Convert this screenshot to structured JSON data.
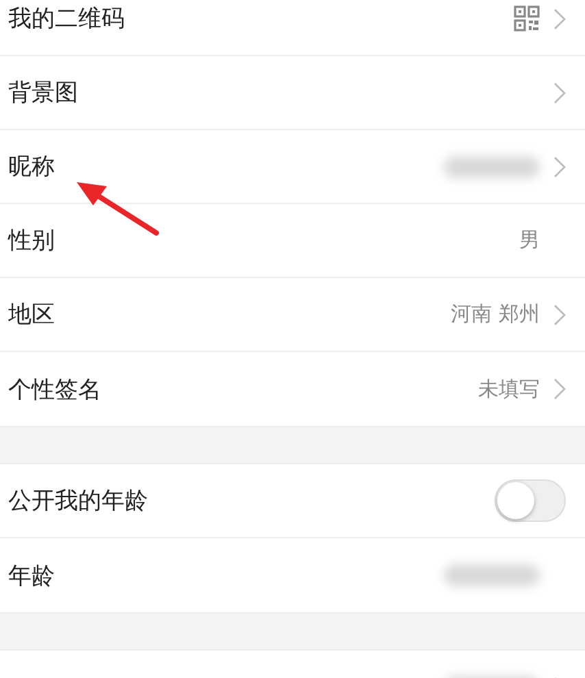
{
  "sections": [
    {
      "rows": [
        {
          "kind": "qr",
          "label": "我的二维码",
          "chevron": true,
          "blurred": false
        },
        {
          "kind": "link",
          "label": "背景图",
          "chevron": true,
          "blurred": false
        },
        {
          "kind": "link",
          "label": "昵称",
          "chevron": true,
          "blurred": true
        },
        {
          "kind": "link",
          "label": "性别",
          "value": "男",
          "chevron": false,
          "blurred": false
        },
        {
          "kind": "link",
          "label": "地区",
          "value": "河南 郑州",
          "chevron": true,
          "blurred": false
        },
        {
          "kind": "link",
          "label": "个性签名",
          "value": "未填写",
          "chevron": true,
          "blurred": false
        }
      ]
    },
    {
      "rows": [
        {
          "kind": "toggle",
          "label": "公开我的年龄",
          "on": false
        },
        {
          "kind": "link",
          "label": "年龄",
          "chevron": false,
          "blurred": true
        }
      ]
    },
    {
      "rows": [
        {
          "kind": "link",
          "chevron": true,
          "blurred": true
        }
      ]
    }
  ],
  "annotation": {
    "kind": "arrow",
    "color": "#e8262a"
  }
}
